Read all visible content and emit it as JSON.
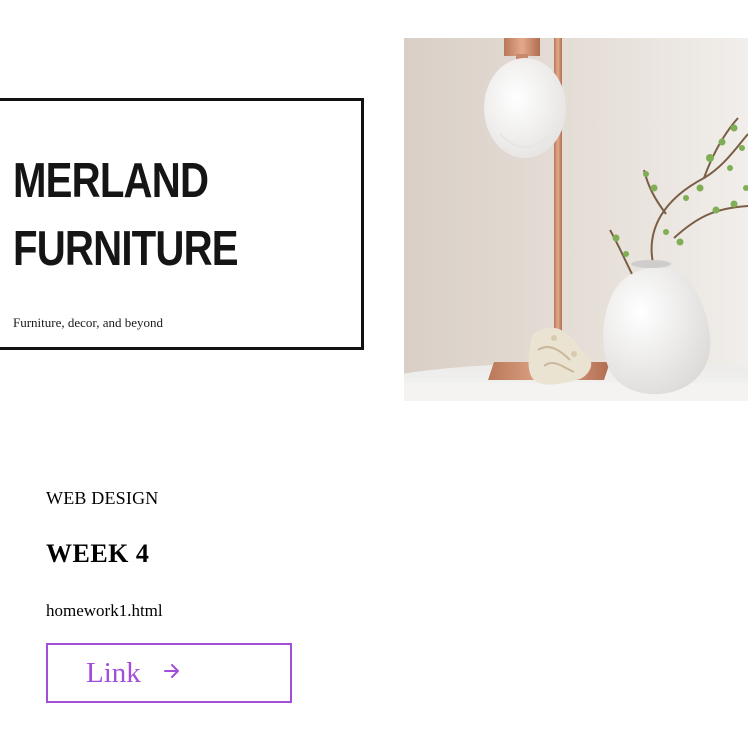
{
  "hero": {
    "brand_title_line1": "MERLAND",
    "brand_title_line2": "FURNITURE",
    "tagline": "Furniture, decor, and beyond",
    "photo_subject": "lamp-and-vase-photo"
  },
  "course": {
    "label": "WEB DESIGN",
    "week": "WEEK 4",
    "file": "homework1.html"
  },
  "link_button": {
    "label": "Link",
    "icon": "arrow-right-icon"
  },
  "colors": {
    "accent": "#a24ed8",
    "border": "#111111",
    "text": "#000000"
  }
}
